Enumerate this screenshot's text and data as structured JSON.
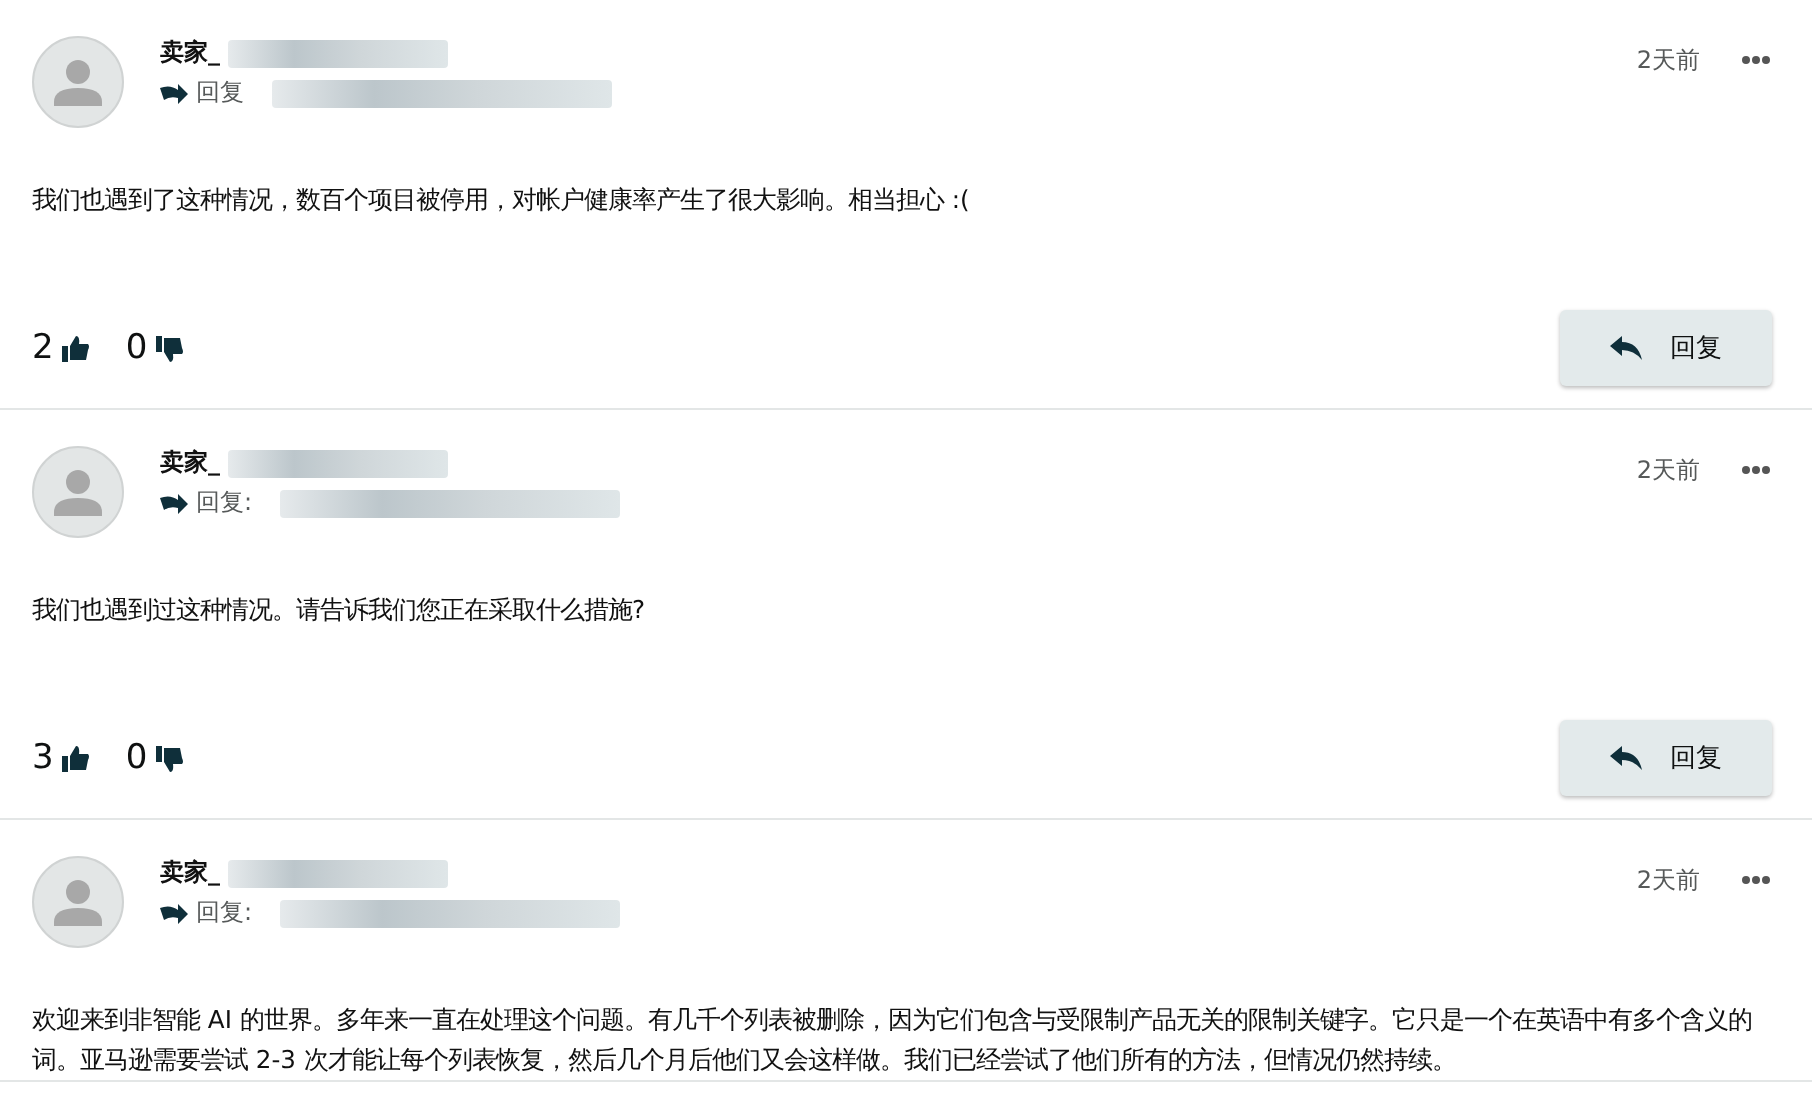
{
  "posts": [
    {
      "author": "卖家_",
      "reply_label": "回复",
      "time": "2天前",
      "body": "我们也遇到了这种情况，数百个项目被停用，对帐户健康率产生了很大影响。相当担心 :(",
      "likes": "2",
      "dislikes": "0",
      "reply_button": "回复"
    },
    {
      "author": "卖家_",
      "reply_label": "回复:",
      "time": "2天前",
      "body": "我们也遇到过这种情况。请告诉我们您正在采取什么措施?",
      "likes": "3",
      "dislikes": "0",
      "reply_button": "回复"
    },
    {
      "author": "卖家_",
      "reply_label": "回复:",
      "time": "2天前",
      "body": "欢迎来到非智能 AI 的世界。多年来一直在处理这个问题。有几千个列表被删除，因为它们包含与受限制产品无关的限制关键字。它只是一个在英语中有多个含义的词。亚马逊需要尝试 2-3 次才能让每个列表恢复，然后几个月后他们又会这样做。我们已经尝试了他们所有的方法，但情况仍然持续。"
    }
  ]
}
